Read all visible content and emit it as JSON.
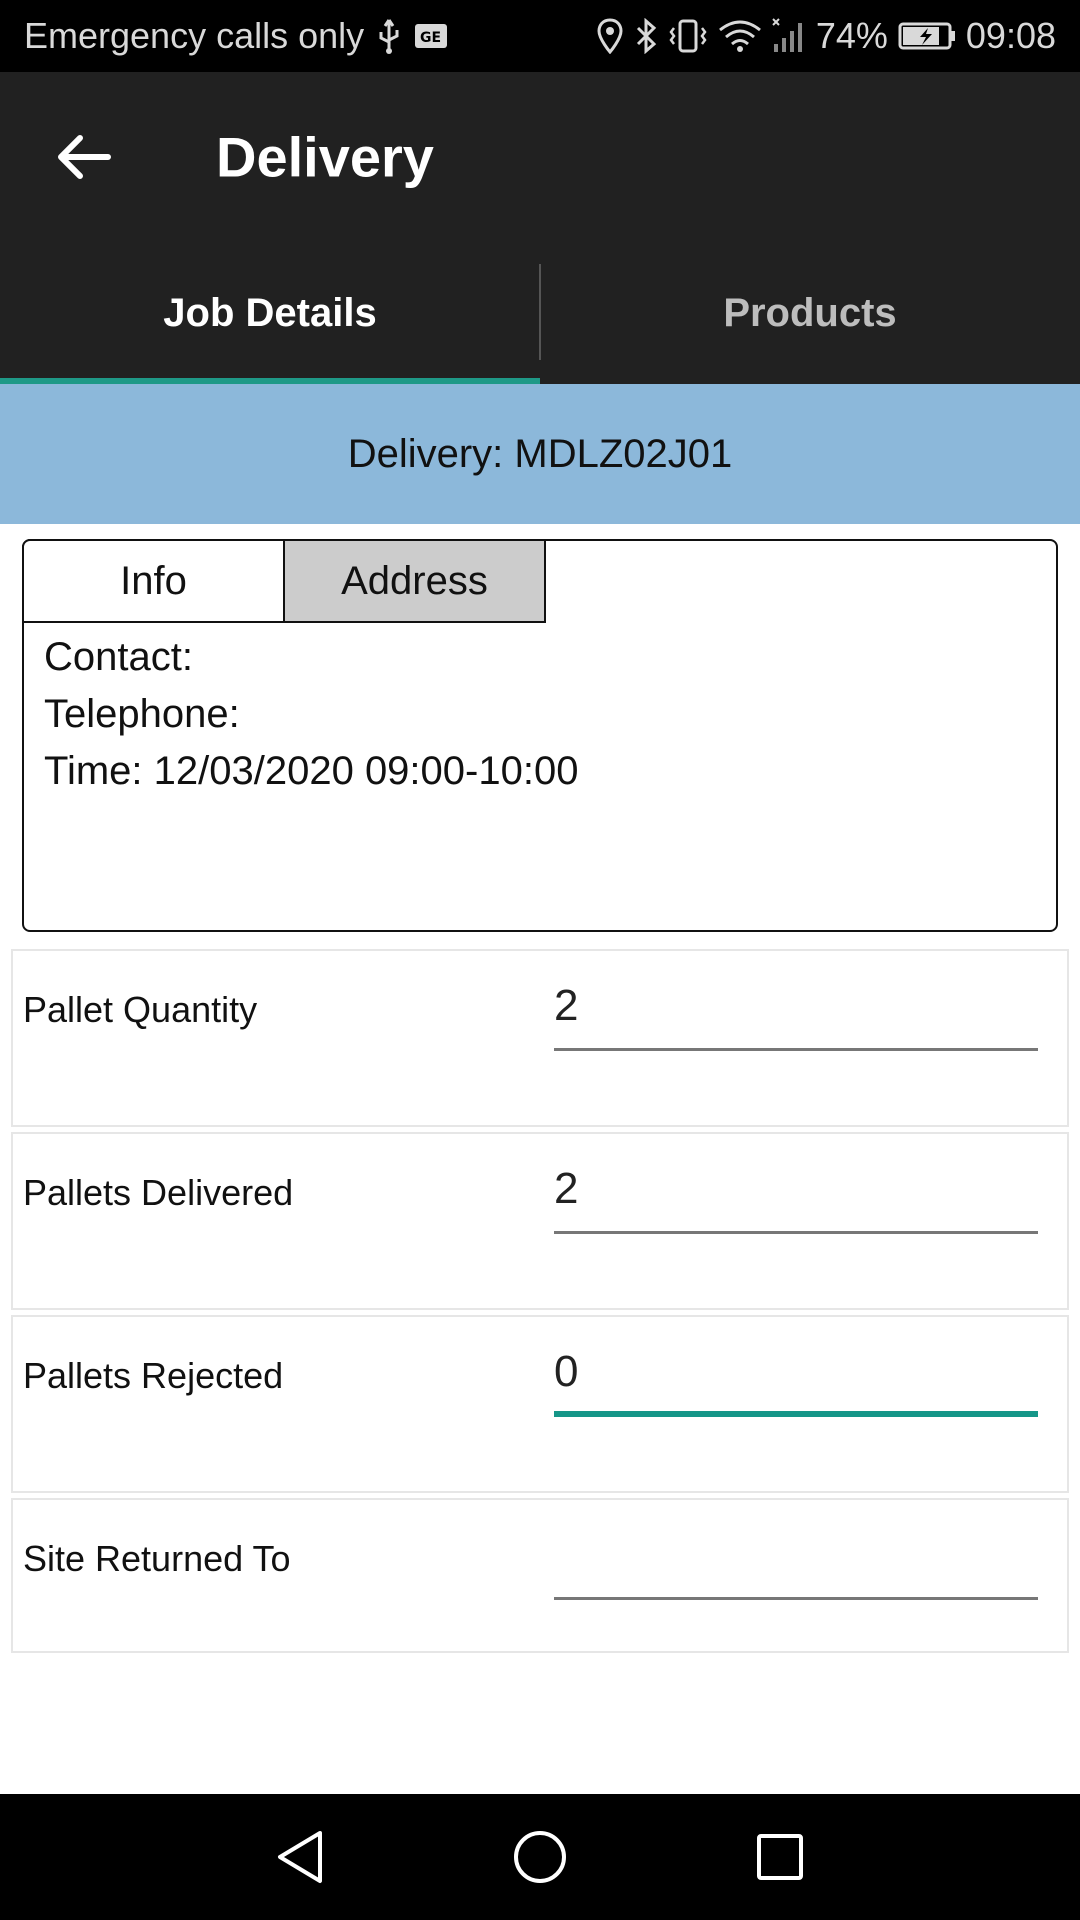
{
  "status_bar": {
    "carrier": "Emergency calls only",
    "battery": "74%",
    "time": "09:08"
  },
  "app_bar": {
    "title": "Delivery"
  },
  "tabs": [
    {
      "label": "Job Details",
      "active": true
    },
    {
      "label": "Products",
      "active": false
    }
  ],
  "banner": {
    "text": "Delivery: MDLZ02J01"
  },
  "info_panel": {
    "tabs": [
      {
        "label": "Info",
        "selected": true
      },
      {
        "label": "Address",
        "selected": false
      }
    ],
    "lines": [
      "Contact:",
      "Telephone:",
      "Time: 12/03/2020 09:00-10:00"
    ]
  },
  "form": [
    {
      "label": "Pallet Quantity",
      "value": "2",
      "focused": false
    },
    {
      "label": "Pallets Delivered",
      "value": "2",
      "focused": false
    },
    {
      "label": "Pallets Rejected",
      "value": "0",
      "focused": true
    },
    {
      "label": "Site Returned To",
      "value": "",
      "focused": false
    }
  ],
  "colors": {
    "accent": "#159688",
    "app_bar": "#212121",
    "banner": "#8cb8da"
  }
}
